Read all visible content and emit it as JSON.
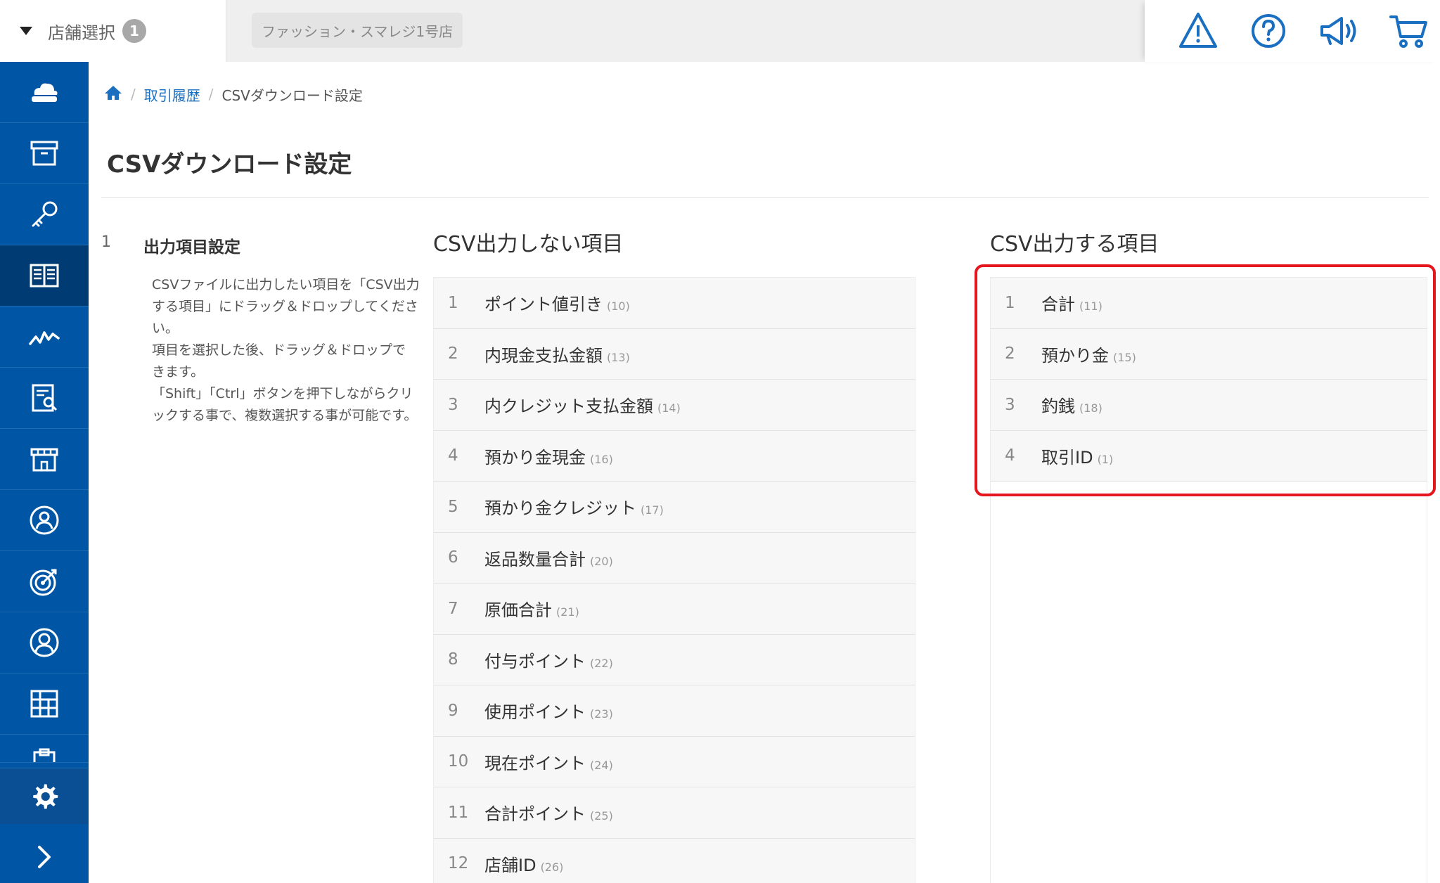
{
  "topbar": {
    "store_select_label": "店舗選択",
    "store_count": "1",
    "current_store": "ファッション・スマレジ1号店",
    "icons": [
      "warning-icon",
      "help-icon",
      "megaphone-icon",
      "cart-icon"
    ],
    "icon_color": "#1a6fc0"
  },
  "sidebar": {
    "color": "#0056a4",
    "active_color": "#003b73",
    "items": [
      {
        "icon": "cloud-register-icon"
      },
      {
        "icon": "archive-box-icon"
      },
      {
        "icon": "key-icon"
      },
      {
        "icon": "book-icon",
        "active": true
      },
      {
        "icon": "chart-line-icon"
      },
      {
        "icon": "report-search-icon"
      },
      {
        "icon": "store-icon"
      },
      {
        "icon": "staff-icon"
      },
      {
        "icon": "target-icon"
      },
      {
        "icon": "customer-icon"
      },
      {
        "icon": "grid-icon"
      },
      {
        "icon": "clipboard-icon"
      }
    ],
    "settings_icon": "gear-icon",
    "expand_icon": "chevron-right-icon"
  },
  "breadcrumb": {
    "home_icon": "home-icon",
    "link": "取引履歴",
    "current": "CSVダウンロード設定"
  },
  "page_title": "CSVダウンロード設定",
  "step": {
    "number": "1",
    "title": "出力項目設定",
    "description_lines": [
      "CSVファイルに出力したい項目を「CSV出力",
      "する項目」にドラッグ＆ドロップしてくださ",
      "い。",
      "項目を選択した後、ドラッグ＆ドロップで",
      "きます。",
      "「Shift」「Ctrl」ボタンを押下しながらクリ",
      "ックする事で、複数選択する事が可能です。"
    ]
  },
  "not_output": {
    "title": "CSV出力しない項目",
    "items": [
      {
        "idx": "1",
        "name": "ポイント値引き",
        "code": "(10)"
      },
      {
        "idx": "2",
        "name": "内現金支払金額",
        "code": "(13)"
      },
      {
        "idx": "3",
        "name": "内クレジット支払金額",
        "code": "(14)"
      },
      {
        "idx": "4",
        "name": "預かり金現金",
        "code": "(16)"
      },
      {
        "idx": "5",
        "name": "預かり金クレジット",
        "code": "(17)"
      },
      {
        "idx": "6",
        "name": "返品数量合計",
        "code": "(20)"
      },
      {
        "idx": "7",
        "name": "原価合計",
        "code": "(21)"
      },
      {
        "idx": "8",
        "name": "付与ポイント",
        "code": "(22)"
      },
      {
        "idx": "9",
        "name": "使用ポイント",
        "code": "(23)"
      },
      {
        "idx": "10",
        "name": "現在ポイント",
        "code": "(24)"
      },
      {
        "idx": "11",
        "name": "合計ポイント",
        "code": "(25)"
      },
      {
        "idx": "12",
        "name": "店舗ID",
        "code": "(26)"
      }
    ]
  },
  "output": {
    "title": "CSV出力する項目",
    "highlight_color": "#e6161e",
    "items": [
      {
        "idx": "1",
        "name": "合計",
        "code": "(11)"
      },
      {
        "idx": "2",
        "name": "預かり金",
        "code": "(15)"
      },
      {
        "idx": "3",
        "name": "釣銭",
        "code": "(18)"
      },
      {
        "idx": "4",
        "name": "取引ID",
        "code": "(1)"
      }
    ]
  }
}
